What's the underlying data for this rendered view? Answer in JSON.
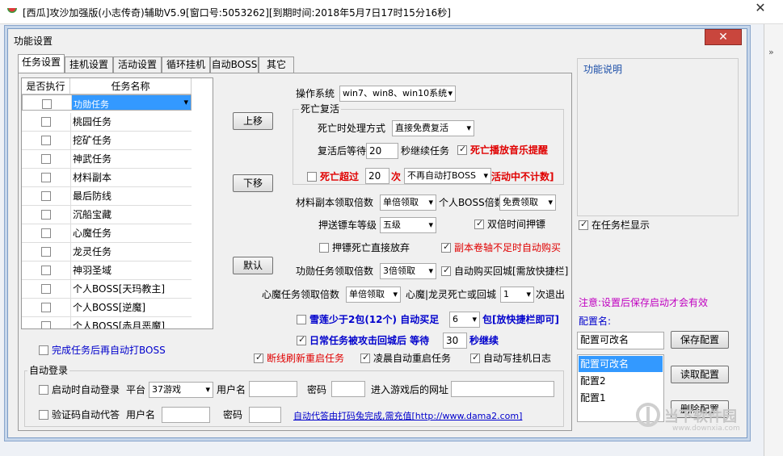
{
  "window": {
    "title": "[西瓜]攻沙加强版(小志传奇)辅助V5.9[窗口号:5053262][到期时间:2018年5月7日17时15分16秒]",
    "close": "✕"
  },
  "dialog": {
    "title": "功能设置",
    "close": "✕"
  },
  "tabs": [
    "任务设置",
    "挂机设置",
    "活动设置",
    "循环挂机",
    "自动BOSS",
    "其它"
  ],
  "task_table": {
    "headers": [
      "是否执行",
      "任务名称"
    ],
    "rows": [
      "功勋任务",
      "桃园任务",
      "挖矿任务",
      "神武任务",
      "材料副本",
      "最后防线",
      "沉船宝藏",
      "心魔任务",
      "龙灵任务",
      "神羽圣域",
      "个人BOSS[天玛教主]",
      "个人BOSS[逆魔]",
      "个人BOSS[赤月恶魔]"
    ]
  },
  "buttons": {
    "up": "上移",
    "down": "下移",
    "default": "默认",
    "save_config": "保存配置",
    "read_config": "读取配置",
    "delete_config": "删除配置"
  },
  "settings": {
    "os_label": "操作系统",
    "os_value": "win7、win8、win10系统",
    "death_group": "死亡复活",
    "death_mode_label": "死亡时处理方式",
    "death_mode_value": "直接免费复活",
    "revive_wait_label": "复活后等待",
    "revive_wait_value": "20",
    "revive_wait_suffix": "秒继续任务",
    "death_music": "死亡播放音乐提醒",
    "death_exceed_label": "死亡超过",
    "death_exceed_value": "20",
    "death_exceed_unit": "次",
    "death_exceed_select": "不再自动打BOSS",
    "death_exceed_suffix": "活动中不计数]",
    "material_label": "材料副本领取倍数",
    "material_value": "单倍领取",
    "personal_boss_label": "个人BOSS倍数",
    "personal_boss_value": "免费领取",
    "escort_label": "押送镖车等级",
    "escort_value": "五级",
    "double_escort": "双倍时间押镖",
    "escort_death": "押镖死亡直接放弃",
    "dungeon_scroll": "副本卷轴不足时自动购买",
    "merit_label": "功勋任务领取倍数",
    "merit_value": "3倍领取",
    "auto_buy_return": "自动购买回城[需放快捷栏]",
    "heart_label": "心魔任务领取倍数",
    "heart_value": "单倍领取",
    "heart_dragon_label": "心魔|龙灵死亡或回城",
    "heart_dragon_value": "1",
    "heart_dragon_suffix": "次退出",
    "snow_lotus_label": "雪莲少于2包(12个) 自动买足",
    "snow_lotus_value": "6",
    "snow_lotus_suffix": "包[放快捷栏即可]",
    "daily_label": "日常任务被攻击回城后 等待",
    "daily_value": "30",
    "daily_suffix": "秒继续",
    "auto_boss_after": "完成任务后再自动打BOSS",
    "reconnect": "断线刷新重启任务",
    "dawn_restart": "凌晨自动重启任务",
    "auto_log": "自动写挂机日志"
  },
  "auto_login": {
    "group": "自动登录",
    "startup_login": "启动时自动登录",
    "platform_label": "平台",
    "platform_value": "37游戏",
    "username_label": "用户名",
    "password_label": "密码",
    "url_label": "进入游戏后的网址",
    "captcha": "验证码自动代答",
    "captcha_user_label": "用户名",
    "captcha_pwd_label": "密码",
    "captcha_link": "自动代答由打码兔完成,需充值[http://www.dama2.com]"
  },
  "right_panel": {
    "func_desc": "功能说明",
    "taskbar_show": "在任务栏显示",
    "note": "注意:设置后保存启动才会有效",
    "config_label": "配置名:",
    "config_value": "配置可改名",
    "config_list": [
      "配置可改名",
      "配置2",
      "配置1"
    ]
  },
  "watermark": {
    "text": "当下软件园",
    "url": "www.downxia.com"
  },
  "colors": {
    "accent": "#3399ff",
    "alert_red": "#e00000",
    "emphasis_blue": "#0000cc",
    "note_purple": "#c000c0",
    "close_red": "#c9463d"
  }
}
